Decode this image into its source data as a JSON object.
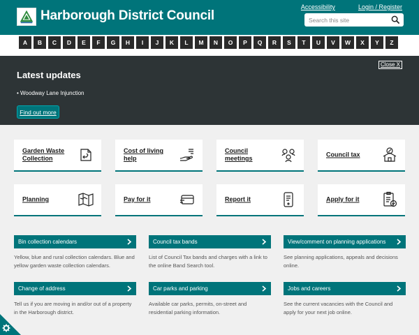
{
  "header": {
    "title": "Harborough District Council",
    "accessibility": "Accessibility",
    "login": "Login / Register",
    "search_placeholder": "Search this site"
  },
  "az": [
    "A",
    "B",
    "C",
    "D",
    "E",
    "F",
    "G",
    "H",
    "I",
    "J",
    "K",
    "L",
    "M",
    "N",
    "O",
    "P",
    "Q",
    "R",
    "S",
    "T",
    "U",
    "V",
    "W",
    "X",
    "Y",
    "Z"
  ],
  "updates": {
    "title": "Latest updates",
    "close": "Close X",
    "item": "• Woodway Lane Injunction",
    "find_more": "Find out more"
  },
  "tiles": [
    {
      "label": "Garden Waste Collection",
      "icon": "recycle-icon"
    },
    {
      "label": "Cost of living help",
      "icon": "hand-coins-icon"
    },
    {
      "label": "Council meetings",
      "icon": "people-icon"
    },
    {
      "label": "Council tax",
      "icon": "house-percent-icon"
    },
    {
      "label": "Planning",
      "icon": "map-icon"
    },
    {
      "label": "Pay for it",
      "icon": "card-icon"
    },
    {
      "label": "Report it",
      "icon": "phone-icon"
    },
    {
      "label": "Apply for it",
      "icon": "checklist-icon"
    }
  ],
  "cards": [
    {
      "title": "Bin collection calendars",
      "desc": "Yellow, blue and rural collection calendars. Blue and yellow garden waste collection calendars."
    },
    {
      "title": "Council tax bands",
      "desc": "List of Council Tax bands and charges with a link to the online Band Search tool."
    },
    {
      "title": "View/comment on planning applications",
      "desc": "See planning applications, appeals and decisions online."
    },
    {
      "title": "Change of address",
      "desc": "Tell us if you are moving in and/or out of a property in the Harborough district."
    },
    {
      "title": "Car parks and parking",
      "desc": "Available car parks, permits, on-street and residential parking information."
    },
    {
      "title": "Jobs and careers",
      "desc": "See the current vacancies with the Council and apply for your next job online."
    }
  ],
  "colors": {
    "brand": "#00747a",
    "dark": "#2d3436"
  }
}
